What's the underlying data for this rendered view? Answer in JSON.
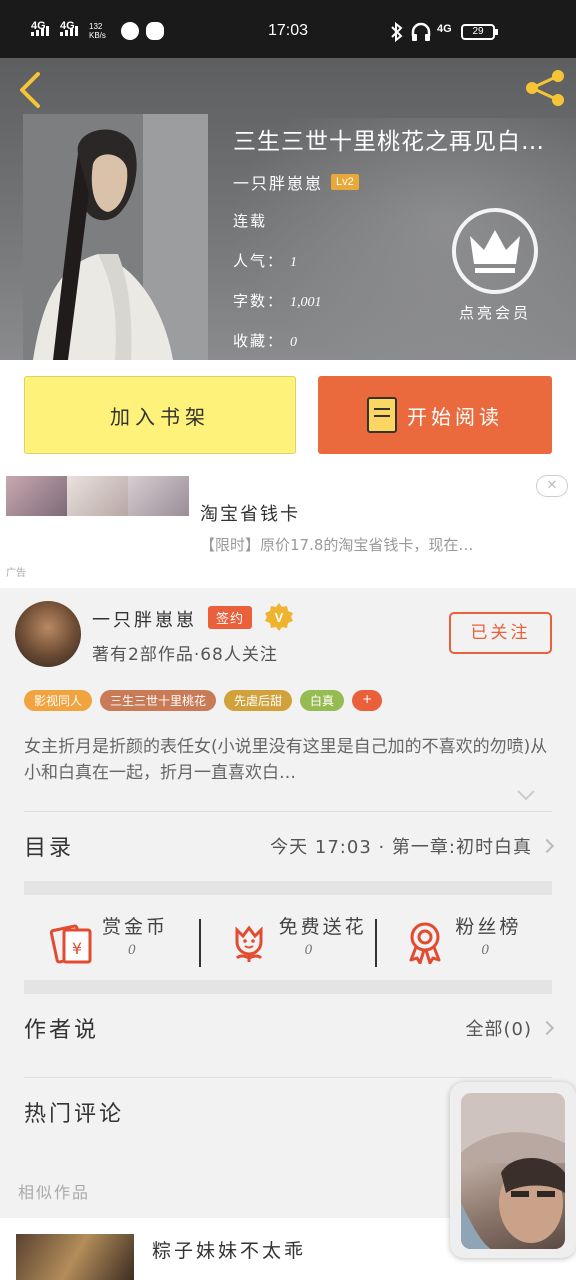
{
  "status_bar": {
    "sig1": "4G",
    "sig2": "4G",
    "speed": "132 KB/s",
    "time": "17:03",
    "net": "4G",
    "battery": "29"
  },
  "book": {
    "title": "三生三世十里桃花之再见白…",
    "author": "一只胖崽崽",
    "author_level": "Lv2",
    "status": "连载",
    "popularity_label": "人气：",
    "popularity": "1",
    "words_label": "字数：",
    "words": "1,001",
    "favorites_label": "收藏：",
    "favorites": "0"
  },
  "vip": {
    "label": "点亮会员"
  },
  "actions": {
    "add_shelf": "加入书架",
    "start_reading": "开始阅读"
  },
  "ad": {
    "title": "淘宝省钱卡",
    "desc": "【限时】原价17.8的淘宝省钱卡，现在…",
    "tag": "广告",
    "close": "✕"
  },
  "author_info": {
    "name": "一只胖崽崽",
    "sign_badge": "签约",
    "verified": "V",
    "stats": "著有2部作品·68人关注",
    "follow": "已关注"
  },
  "tags": [
    {
      "label": "影视同人",
      "color": "#f0a33e"
    },
    {
      "label": "三生三世十里桃花",
      "color": "#c97b57"
    },
    {
      "label": "先虐后甜",
      "color": "#d1a13c"
    },
    {
      "label": "白真",
      "color": "#97bb53"
    },
    {
      "label": "+",
      "color": "#e9603b"
    }
  ],
  "intro": "女主折月是折颜的表任女(小说里没有这里是自己加的不喜欢的勿喷)从小和白真在一起，折月一直喜欢白…",
  "toc": {
    "label": "目录",
    "latest": "今天 17:03 · 第一章:初时白真"
  },
  "gifts": [
    {
      "label": "赏金币",
      "value": "0",
      "icon": "red-envelope-icon"
    },
    {
      "label": "免费送花",
      "value": "0",
      "icon": "flower-icon"
    },
    {
      "label": "粉丝榜",
      "value": "0",
      "icon": "medal-icon"
    }
  ],
  "author_says": {
    "label": "作者说",
    "all": "全部(0)"
  },
  "hot_comments": {
    "label": "热门评论"
  },
  "similar": {
    "label": "相似作品",
    "items": [
      {
        "title": "粽子妹妹不太乖"
      }
    ]
  },
  "colors": {
    "accent": "#e9603b",
    "shelf_yellow": "#fef27a",
    "icon_yellow": "#f6c536"
  }
}
